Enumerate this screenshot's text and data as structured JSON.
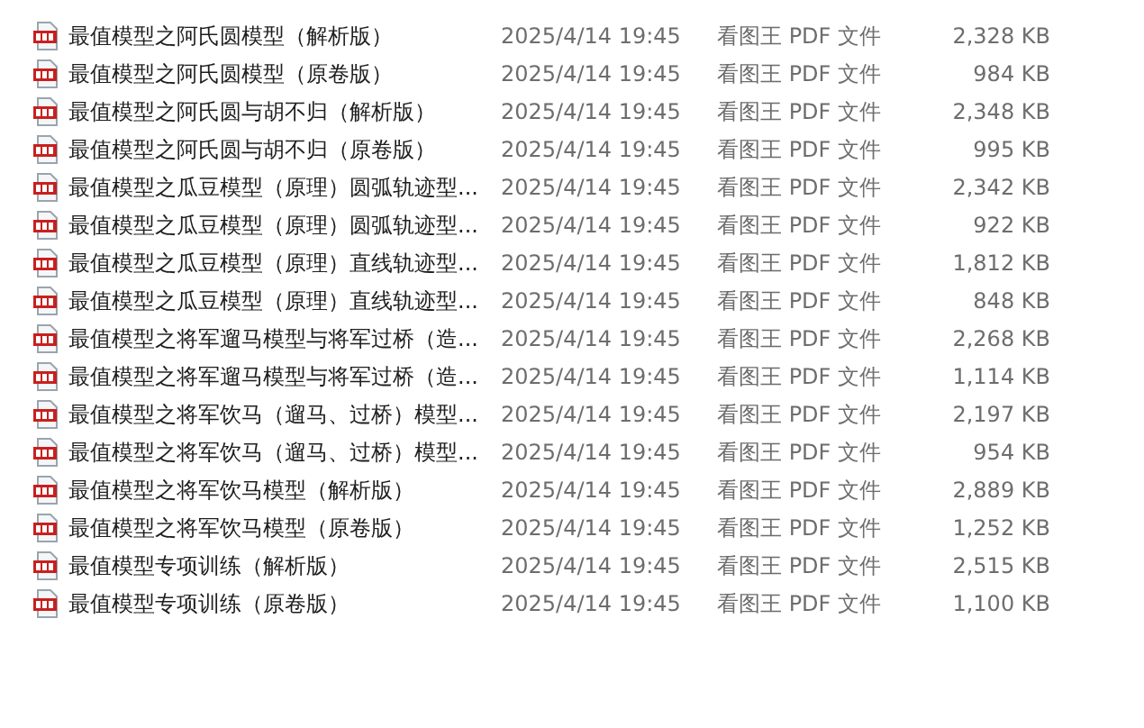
{
  "files": [
    {
      "name": "最值模型之阿氏圆模型（解析版）",
      "modified": "2025/4/14 19:45",
      "type": "看图王 PDF 文件",
      "size": "2,328 KB"
    },
    {
      "name": "最值模型之阿氏圆模型（原卷版）",
      "modified": "2025/4/14 19:45",
      "type": "看图王 PDF 文件",
      "size": "984 KB"
    },
    {
      "name": "最值模型之阿氏圆与胡不归（解析版）",
      "modified": "2025/4/14 19:45",
      "type": "看图王 PDF 文件",
      "size": "2,348 KB"
    },
    {
      "name": "最值模型之阿氏圆与胡不归（原卷版）",
      "modified": "2025/4/14 19:45",
      "type": "看图王 PDF 文件",
      "size": "995 KB"
    },
    {
      "name": "最值模型之瓜豆模型（原理）圆弧轨迹型...",
      "modified": "2025/4/14 19:45",
      "type": "看图王 PDF 文件",
      "size": "2,342 KB"
    },
    {
      "name": "最值模型之瓜豆模型（原理）圆弧轨迹型...",
      "modified": "2025/4/14 19:45",
      "type": "看图王 PDF 文件",
      "size": "922 KB"
    },
    {
      "name": "最值模型之瓜豆模型（原理）直线轨迹型...",
      "modified": "2025/4/14 19:45",
      "type": "看图王 PDF 文件",
      "size": "1,812 KB"
    },
    {
      "name": "最值模型之瓜豆模型（原理）直线轨迹型...",
      "modified": "2025/4/14 19:45",
      "type": "看图王 PDF 文件",
      "size": "848 KB"
    },
    {
      "name": "最值模型之将军遛马模型与将军过桥（造...",
      "modified": "2025/4/14 19:45",
      "type": "看图王 PDF 文件",
      "size": "2,268 KB"
    },
    {
      "name": "最值模型之将军遛马模型与将军过桥（造...",
      "modified": "2025/4/14 19:45",
      "type": "看图王 PDF 文件",
      "size": "1,114 KB"
    },
    {
      "name": "最值模型之将军饮马（遛马、过桥）模型...",
      "modified": "2025/4/14 19:45",
      "type": "看图王 PDF 文件",
      "size": "2,197 KB"
    },
    {
      "name": "最值模型之将军饮马（遛马、过桥）模型...",
      "modified": "2025/4/14 19:45",
      "type": "看图王 PDF 文件",
      "size": "954 KB"
    },
    {
      "name": "最值模型之将军饮马模型（解析版）",
      "modified": "2025/4/14 19:45",
      "type": "看图王 PDF 文件",
      "size": "2,889 KB"
    },
    {
      "name": "最值模型之将军饮马模型（原卷版）",
      "modified": "2025/4/14 19:45",
      "type": "看图王 PDF 文件",
      "size": "1,252 KB"
    },
    {
      "name": "最值模型专项训练（解析版）",
      "modified": "2025/4/14 19:45",
      "type": "看图王 PDF 文件",
      "size": "2,515 KB"
    },
    {
      "name": "最值模型专项训练（原卷版）",
      "modified": "2025/4/14 19:45",
      "type": "看图王 PDF 文件",
      "size": "1,100 KB"
    }
  ]
}
